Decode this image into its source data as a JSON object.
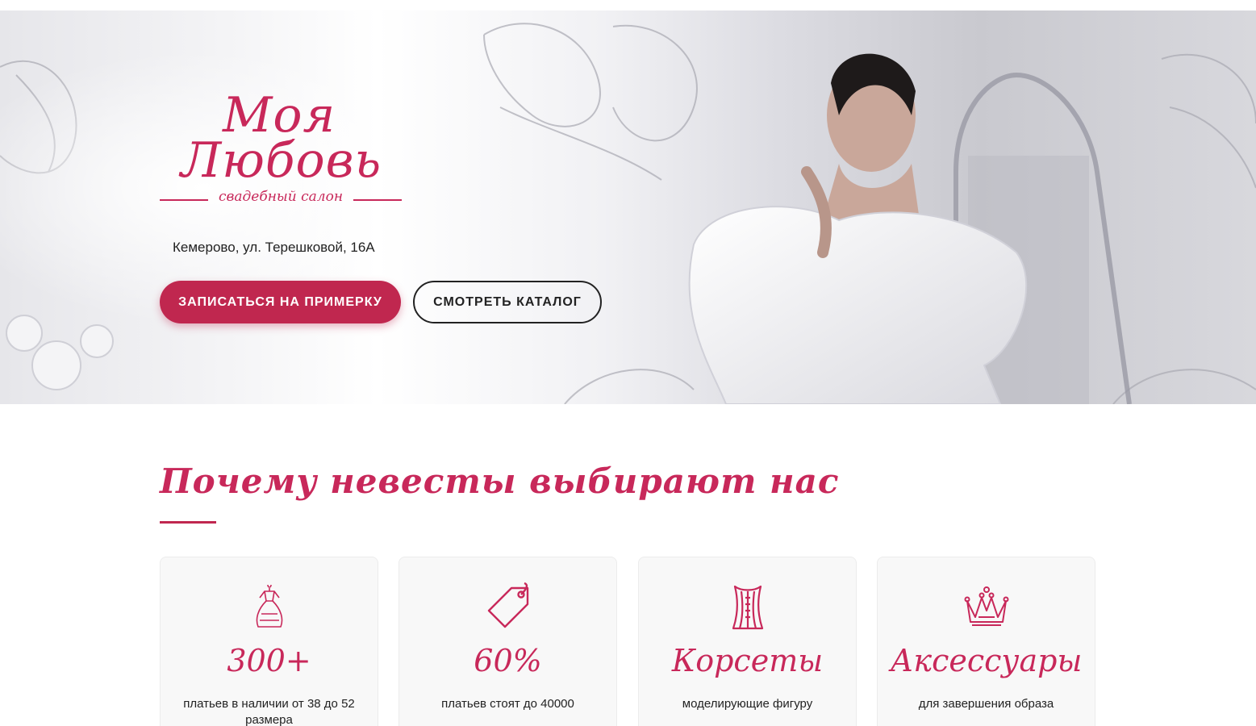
{
  "hero": {
    "logo_line1": "Моя",
    "logo_line2": "Любовь",
    "logo_subtitle": "свадебный салон",
    "address": "Кемерово, ул. Терешковой, 16А",
    "primary_button": "ЗАПИСАТЬСЯ НА ПРИМЕРКУ",
    "secondary_button": "СМОТРЕТЬ КАТАЛОГ"
  },
  "features": {
    "title": "Почему невесты выбирают нас",
    "cards": [
      {
        "icon": "dress-icon",
        "value": "300+",
        "text": "платьев в наличии от 38 до 52 размера"
      },
      {
        "icon": "price-tag-icon",
        "value": "60%",
        "text": "платьев стоят до 40000"
      },
      {
        "icon": "corset-icon",
        "value": "Корсеты",
        "text": "моделирующие фигуру"
      },
      {
        "icon": "crown-icon",
        "value": "Аксессуары",
        "text": "для завершения образа"
      }
    ]
  },
  "colors": {
    "accent": "#c0274f",
    "accent_text": "#c8285a",
    "card_bg": "#f8f8f8"
  }
}
